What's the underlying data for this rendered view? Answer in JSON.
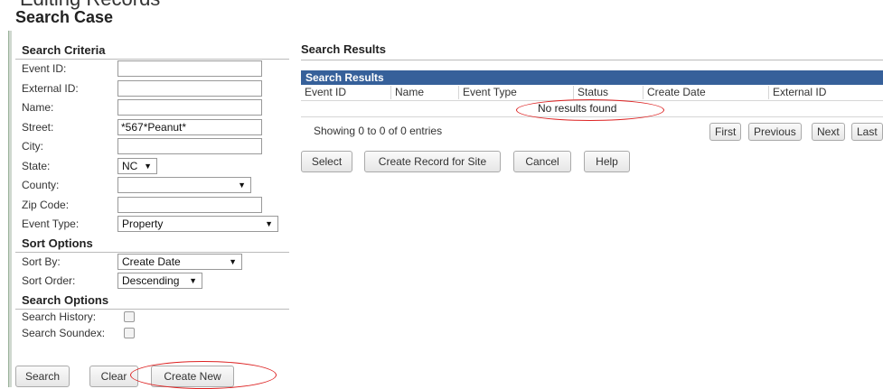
{
  "header": {
    "cropped_text": "Editing Records",
    "title": "Search Case"
  },
  "search_criteria": {
    "heading": "Search Criteria",
    "event_id": {
      "label": "Event ID:",
      "value": ""
    },
    "external_id": {
      "label": "External ID:",
      "value": ""
    },
    "name": {
      "label": "Name:",
      "value": ""
    },
    "street": {
      "label": "Street:",
      "value": "*567*Peanut*"
    },
    "city": {
      "label": "City:",
      "value": ""
    },
    "state": {
      "label": "State:",
      "value": "NC"
    },
    "county": {
      "label": "County:",
      "value": ""
    },
    "zip": {
      "label": "Zip Code:",
      "value": ""
    },
    "event_type": {
      "label": "Event Type:",
      "value": "Property"
    }
  },
  "sort_options": {
    "heading": "Sort Options",
    "sort_by": {
      "label": "Sort By:",
      "value": "Create Date"
    },
    "sort_order": {
      "label": "Sort Order:",
      "value": "Descending"
    }
  },
  "search_options": {
    "heading": "Search Options",
    "history": {
      "label": "Search History:",
      "checked": false
    },
    "soundex": {
      "label": "Search Soundex:",
      "checked": false
    }
  },
  "left_buttons": {
    "search": "Search",
    "clear": "Clear",
    "create_new": "Create New"
  },
  "results": {
    "section_title": "Search Results",
    "grid_title": "Search Results",
    "columns": [
      "Event ID",
      "Name",
      "Event Type",
      "Status",
      "Create Date",
      "External ID"
    ],
    "empty_text": "No results found",
    "showing": "Showing 0 to 0 of 0 entries",
    "pager": {
      "first": "First",
      "previous": "Previous",
      "next": "Next",
      "last": "Last"
    },
    "actions": {
      "select": "Select",
      "create_record": "Create Record for Site",
      "cancel": "Cancel",
      "help": "Help"
    }
  },
  "colors": {
    "grid_header": "#36609a",
    "annotation": "#dd2222"
  }
}
